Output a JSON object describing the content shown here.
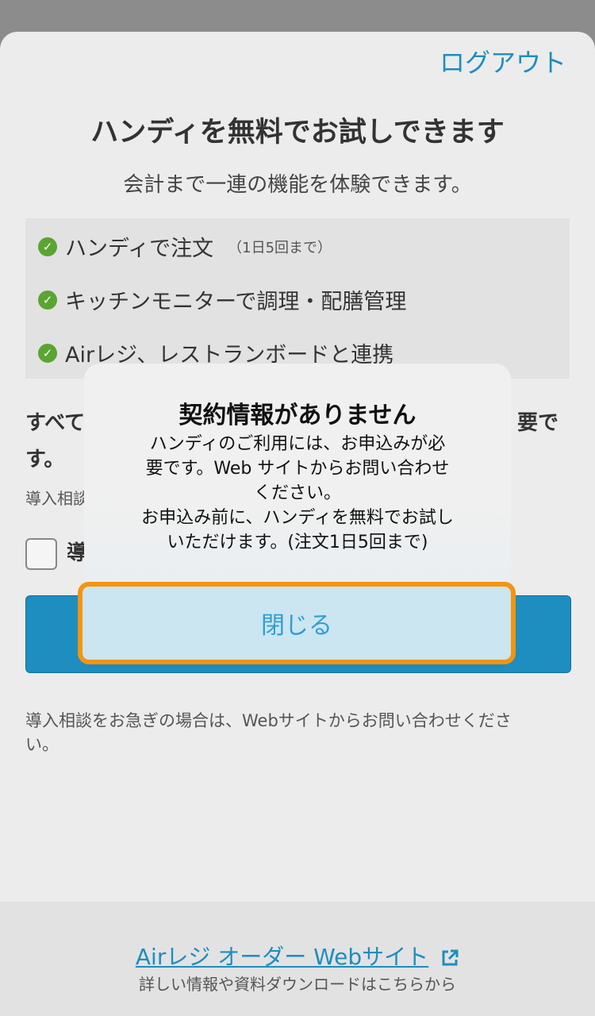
{
  "header": {
    "logout_label": "ログアウト"
  },
  "main": {
    "title": "ハンディを無料でお試しできます",
    "subtitle": "会計まで一連の機能を体験できます。",
    "features": [
      {
        "label": "ハンディで注文",
        "note": "（1日5回まで）"
      },
      {
        "label": "キッチンモニターで調理・配膳管理"
      },
      {
        "label": "Airレジ、レストランボードと連携"
      }
    ],
    "requirement_start": "すべて",
    "requirement_end": "要で",
    "requirement_line2": "す。",
    "requirement_small": "導入相談",
    "checkbox_label": "導",
    "bottom_note": "導入相談をお急ぎの場合は、Webサイトからお問い合わせください。"
  },
  "footer": {
    "link_label": "Airレジ オーダー Webサイト",
    "sub_label": "詳しい情報や資料ダウンロードはこちらから"
  },
  "dialog": {
    "title": "契約情報がありません",
    "body_line1": "ハンディのご利用には、お申込みが必",
    "body_line2": "要です。Web サイトからお問い合わせ",
    "body_line3": "ください。",
    "body_line4": "お申込み前に、ハンディを無料でお試し",
    "body_line5": "いただけます。(注文1日5回まで)",
    "close_label": "閉じる"
  },
  "colors": {
    "accent": "#1e8dbf",
    "highlight": "#f5940f",
    "check": "#5aa532"
  }
}
